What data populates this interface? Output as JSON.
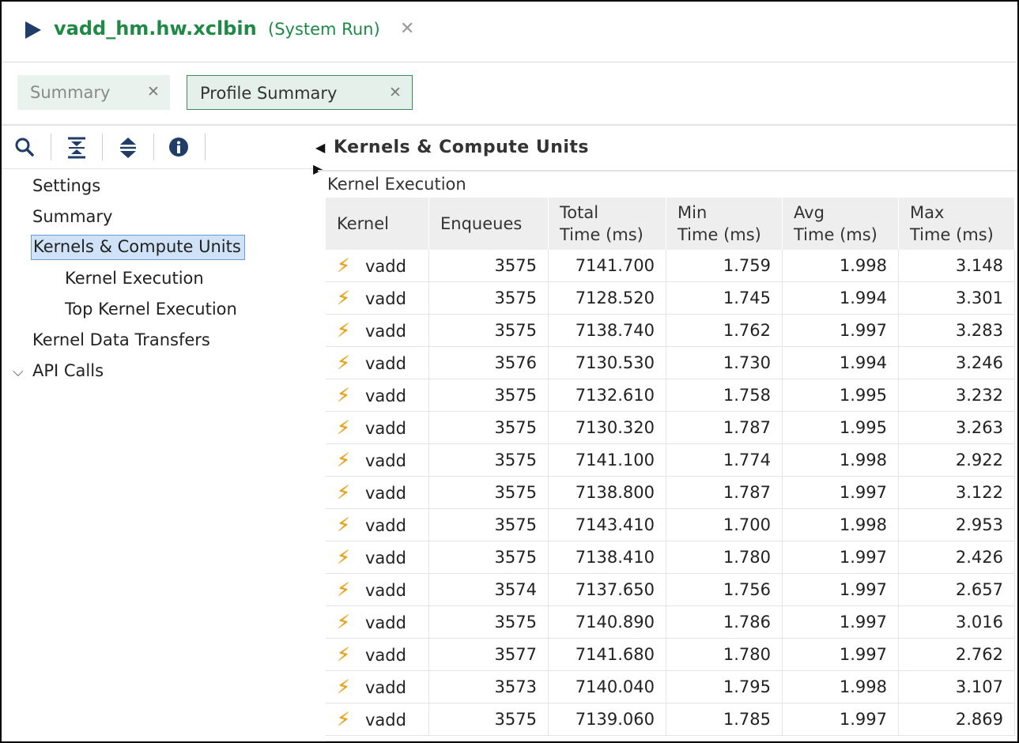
{
  "title": {
    "name": "vadd_hm.hw.xclbin",
    "subtitle": "(System Run)",
    "close_glyph": "✕"
  },
  "tabs": [
    {
      "label": "Summary",
      "close": "✕",
      "active": false
    },
    {
      "label": "Profile Summary",
      "close": "✕",
      "active": true
    }
  ],
  "toolbar": {
    "icons": [
      "search-icon",
      "collapse-all-icon",
      "expand-all-icon",
      "info-icon"
    ]
  },
  "tree": {
    "items": [
      {
        "label": "Settings",
        "level": 0
      },
      {
        "label": "Summary",
        "level": 0
      },
      {
        "label": "Kernels & Compute Units",
        "level": 0,
        "expanded": true,
        "selected": true
      },
      {
        "label": "Kernel Execution",
        "level": 1
      },
      {
        "label": "Top Kernel Execution",
        "level": 1
      },
      {
        "label": "Kernel Data Transfers",
        "level": 0
      },
      {
        "label": "API Calls",
        "level": 0
      }
    ]
  },
  "main": {
    "section_title": "Kernels & Compute Units",
    "table_title": "Kernel Execution",
    "columns": [
      {
        "line1": "Kernel",
        "line2": ""
      },
      {
        "line1": "Enqueues",
        "line2": ""
      },
      {
        "line1": "Total",
        "line2": "Time (ms)"
      },
      {
        "line1": "Min",
        "line2": "Time (ms)"
      },
      {
        "line1": "Avg",
        "line2": "Time (ms)"
      },
      {
        "line1": "Max",
        "line2": "Time (ms)"
      }
    ],
    "rows": [
      [
        "vadd",
        "3575",
        "7141.700",
        "1.759",
        "1.998",
        "3.148"
      ],
      [
        "vadd",
        "3575",
        "7128.520",
        "1.745",
        "1.994",
        "3.301"
      ],
      [
        "vadd",
        "3575",
        "7138.740",
        "1.762",
        "1.997",
        "3.283"
      ],
      [
        "vadd",
        "3576",
        "7130.530",
        "1.730",
        "1.994",
        "3.246"
      ],
      [
        "vadd",
        "3575",
        "7132.610",
        "1.758",
        "1.995",
        "3.232"
      ],
      [
        "vadd",
        "3575",
        "7130.320",
        "1.787",
        "1.995",
        "3.263"
      ],
      [
        "vadd",
        "3575",
        "7141.100",
        "1.774",
        "1.998",
        "2.922"
      ],
      [
        "vadd",
        "3575",
        "7138.800",
        "1.787",
        "1.997",
        "3.122"
      ],
      [
        "vadd",
        "3575",
        "7143.410",
        "1.700",
        "1.998",
        "2.953"
      ],
      [
        "vadd",
        "3575",
        "7138.410",
        "1.780",
        "1.997",
        "2.426"
      ],
      [
        "vadd",
        "3574",
        "7137.650",
        "1.756",
        "1.997",
        "2.657"
      ],
      [
        "vadd",
        "3575",
        "7140.890",
        "1.786",
        "1.997",
        "3.016"
      ],
      [
        "vadd",
        "3577",
        "7141.680",
        "1.780",
        "1.997",
        "2.762"
      ],
      [
        "vadd",
        "3573",
        "7140.040",
        "1.795",
        "1.998",
        "3.107"
      ],
      [
        "vadd",
        "3575",
        "7139.060",
        "1.785",
        "1.997",
        "2.869"
      ]
    ],
    "row_icon": "kernel-bolt-icon"
  },
  "colors": {
    "title_green": "#1e8a45",
    "icon_navy": "#1f3d66",
    "tab_active_border": "#3f8a5c",
    "selection_bg": "#cfe2f7",
    "bolt": "#e8a317"
  }
}
